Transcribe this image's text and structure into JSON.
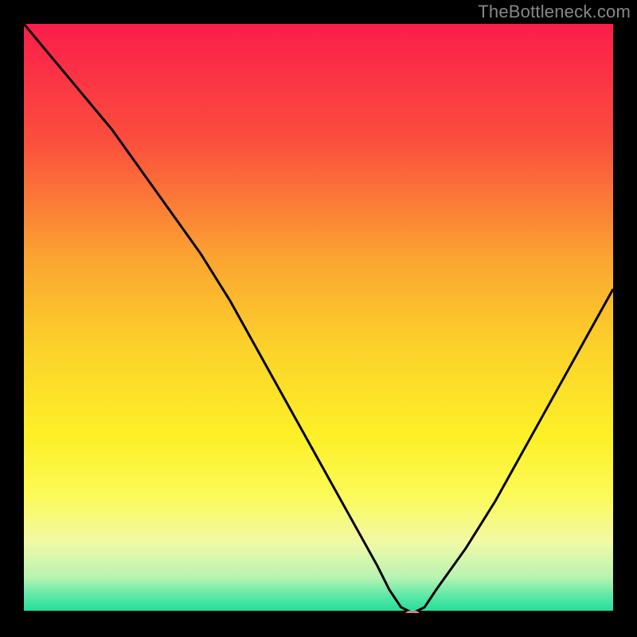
{
  "watermark": "TheBottleneck.com",
  "chart_data": {
    "type": "line",
    "title": "",
    "xlabel": "",
    "ylabel": "",
    "xlim": [
      0,
      100
    ],
    "ylim": [
      0,
      100
    ],
    "x": [
      0,
      5,
      10,
      15,
      20,
      25,
      30,
      35,
      40,
      45,
      50,
      55,
      60,
      62,
      64,
      66,
      68,
      70,
      75,
      80,
      85,
      90,
      95,
      100
    ],
    "values": [
      100,
      94,
      88,
      82,
      75,
      68,
      61,
      53,
      44,
      35,
      26,
      17,
      8,
      4,
      1,
      0,
      1,
      4,
      11,
      19,
      28,
      37,
      46,
      55
    ],
    "min_x": 66,
    "marker": {
      "x": 66,
      "y": 0
    },
    "background_gradient": {
      "stops": [
        {
          "position": 0.0,
          "color": "#fb1d4b"
        },
        {
          "position": 0.2,
          "color": "#fb4f3d"
        },
        {
          "position": 0.4,
          "color": "#fba531"
        },
        {
          "position": 0.55,
          "color": "#fcd22a"
        },
        {
          "position": 0.7,
          "color": "#fdf027"
        },
        {
          "position": 0.8,
          "color": "#fcfa58"
        },
        {
          "position": 0.88,
          "color": "#f1f9a6"
        },
        {
          "position": 0.94,
          "color": "#b7f3b2"
        },
        {
          "position": 0.97,
          "color": "#5ee8a8"
        },
        {
          "position": 1.0,
          "color": "#1bdc98"
        }
      ]
    }
  }
}
